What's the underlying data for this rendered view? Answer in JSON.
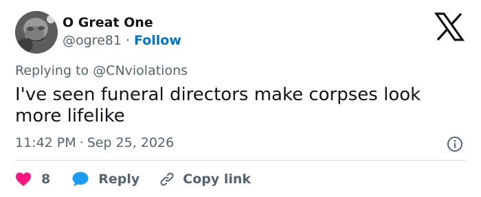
{
  "author": {
    "name": "O Great One",
    "handle": "@ogre81",
    "separator": "·",
    "follow_label": "Follow"
  },
  "reply_context": {
    "prefix": "Replying to",
    "mention": "@CNviolations"
  },
  "tweet": {
    "text": "I've seen funeral directors make corpses look more lifelike"
  },
  "meta": {
    "time": "11:42 PM",
    "separator": "·",
    "date": "Sep 25, 2026"
  },
  "actions": {
    "like_count": "8",
    "reply_label": "Reply",
    "copy_label": "Copy link"
  },
  "colors": {
    "text_primary": "#0f1419",
    "text_secondary": "#536471",
    "follow_blue": "#0074d4",
    "heart_pink": "#f91880",
    "reply_blue": "#1d9bf0",
    "divider": "#cfd9de"
  },
  "icons": {
    "platform": "x-logo-icon",
    "info": "info-icon",
    "like": "heart-icon",
    "reply": "speech-bubble-icon",
    "copy": "link-icon"
  }
}
